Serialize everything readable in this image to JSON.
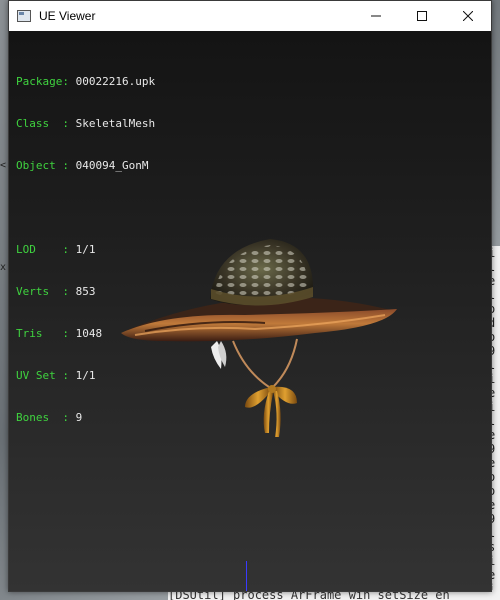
{
  "window": {
    "title": "UE Viewer",
    "controls": {
      "minimize": "—",
      "maximize": "☐",
      "close": "✕"
    }
  },
  "info": {
    "package_label": "Package:",
    "package_value": "00022216.upk",
    "class_label": "Class  :",
    "class_value": "SkeletalMesh",
    "object_label": "Object :",
    "object_value": "040094_GonM",
    "lod_label": "LOD    :",
    "lod_value": "1/1",
    "verts_label": "Verts  :",
    "verts_value": "853",
    "tris_label": "Tris   :",
    "tris_value": "1048",
    "uvset_label": "UV Set :",
    "uvset_value": "1/1",
    "bones_label": "Bones  :",
    "bones_value": "9"
  },
  "background_console": {
    "bottom_text": "[DSUtil] process  ArFrame win setSize  en",
    "side_chars": [
      "i",
      "l",
      "e",
      "l",
      "o",
      "d",
      "o",
      "9",
      "l",
      "i",
      "e",
      "i",
      "l",
      "e",
      "9",
      "e",
      "o",
      "o",
      "e",
      "9",
      "l",
      "s",
      "i",
      "e",
      "i",
      "o"
    ],
    "left_marks": [
      "<",
      "x"
    ]
  },
  "colors": {
    "label_green": "#3fd33f",
    "value_white": "#e8e8e8",
    "viewport_top": "#141414",
    "viewport_bottom": "#333333"
  },
  "model": {
    "icon": "straw-hat-mesh"
  }
}
